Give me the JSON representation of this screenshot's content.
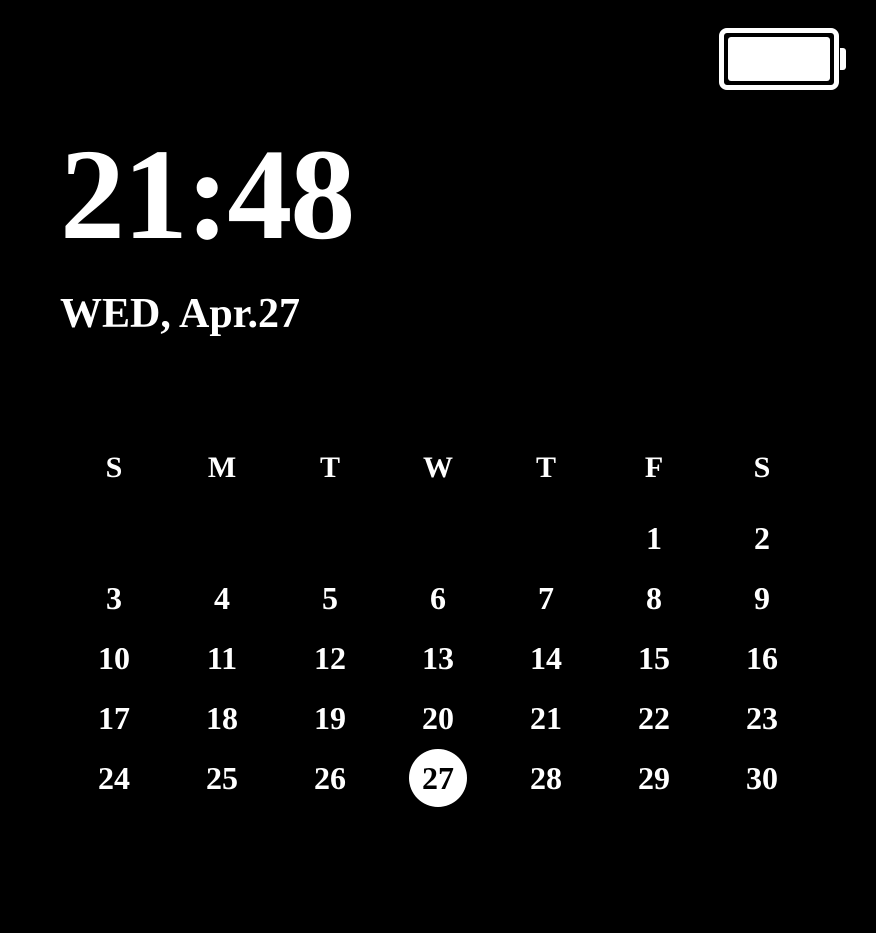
{
  "battery": {
    "level": 100
  },
  "clock": {
    "time": "21:48",
    "date": "WED, Apr.27"
  },
  "calendar": {
    "weekdays": [
      "S",
      "M",
      "T",
      "W",
      "T",
      "F",
      "S"
    ],
    "weeks": [
      [
        "",
        "",
        "",
        "",
        "",
        "1",
        "2"
      ],
      [
        "3",
        "4",
        "5",
        "6",
        "7",
        "8",
        "9"
      ],
      [
        "10",
        "11",
        "12",
        "13",
        "14",
        "15",
        "16"
      ],
      [
        "17",
        "18",
        "19",
        "20",
        "21",
        "22",
        "23"
      ],
      [
        "24",
        "25",
        "26",
        "27",
        "28",
        "29",
        "30"
      ]
    ],
    "today": "27"
  }
}
